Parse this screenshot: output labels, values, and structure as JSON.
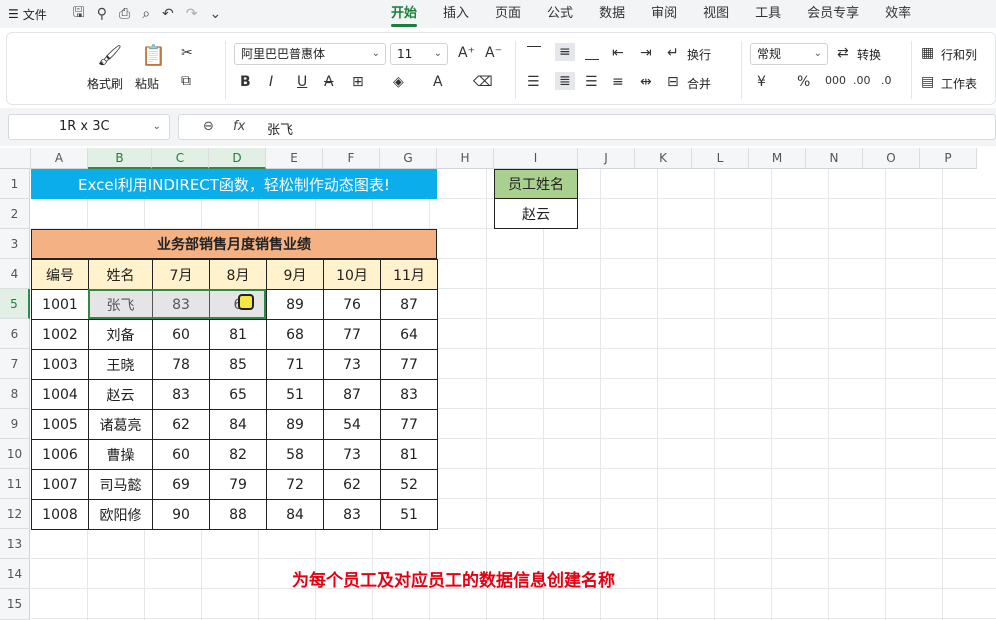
{
  "menu": {
    "label": "文件"
  },
  "tabs": [
    "开始",
    "插入",
    "页面",
    "公式",
    "数据",
    "审阅",
    "视图",
    "工具",
    "会员专享",
    "效率"
  ],
  "ribbon": {
    "format_painter": "格式刷",
    "paste": "粘贴",
    "font_name": "阿里巴巴普惠体",
    "font_size": "11",
    "wrap": "换行",
    "merge": "合并",
    "number_format": "常规",
    "convert": "转换",
    "row_col": "行和列",
    "worksheet": "工作表",
    "bold": "B",
    "italic": "I",
    "underline": "U",
    "strike": "A"
  },
  "namebox": "1R x 3C",
  "formula": {
    "fx": "fx",
    "value": "张飞"
  },
  "columns": [
    "A",
    "B",
    "C",
    "D",
    "E",
    "F",
    "G",
    "H",
    "I",
    "J",
    "K",
    "L",
    "M",
    "N",
    "O",
    "P"
  ],
  "rows": [
    "1",
    "2",
    "3",
    "4",
    "5",
    "6",
    "7",
    "8",
    "9",
    "10",
    "11",
    "12",
    "13",
    "14",
    "15"
  ],
  "title": "Excel利用INDIRECT函数，轻松制作动态图表!",
  "table_title": "业务部销售月度销售业绩",
  "headers": [
    "编号",
    "姓名",
    "7月",
    "8月",
    "9月",
    "10月",
    "11月"
  ],
  "data": [
    [
      "1001",
      "张飞",
      "83",
      "6",
      "89",
      "76",
      "87"
    ],
    [
      "1002",
      "刘备",
      "60",
      "81",
      "68",
      "77",
      "64"
    ],
    [
      "1003",
      "王晓",
      "78",
      "85",
      "71",
      "73",
      "77"
    ],
    [
      "1004",
      "赵云",
      "83",
      "65",
      "51",
      "87",
      "83"
    ],
    [
      "1005",
      "诸葛亮",
      "62",
      "84",
      "89",
      "54",
      "77"
    ],
    [
      "1006",
      "曹操",
      "60",
      "82",
      "58",
      "73",
      "81"
    ],
    [
      "1007",
      "司马懿",
      "69",
      "79",
      "72",
      "62",
      "52"
    ],
    [
      "1008",
      "欧阳修",
      "90",
      "88",
      "84",
      "83",
      "51"
    ]
  ],
  "lookup": {
    "label": "员工姓名",
    "value": "赵云"
  },
  "note": "为每个员工及对应员工的数据信息创建名称"
}
